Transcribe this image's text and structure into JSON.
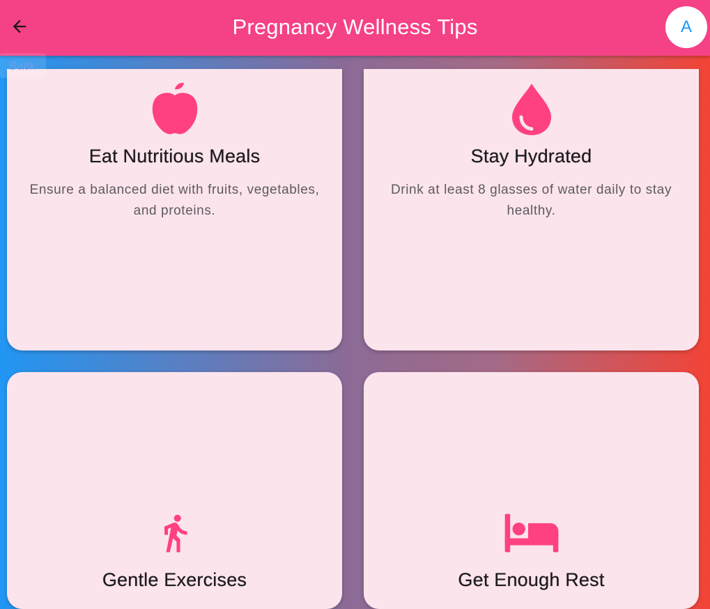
{
  "app_bar": {
    "title": "Pregnancy Wellness Tips",
    "avatar_letter": "A",
    "back_label": "Back",
    "color": "#F54185"
  },
  "tips": [
    {
      "title": "Eat Nutritious Meals",
      "description": "Ensure a balanced diet with fruits, vegetables, and proteins.",
      "icon": "apple-icon"
    },
    {
      "title": "Stay Hydrated",
      "description": "Drink at least 8 glasses of water daily to stay healthy.",
      "icon": "water-drop-icon"
    },
    {
      "title": "Gentle Exercises",
      "description": "",
      "icon": "walking-icon"
    },
    {
      "title": "Get Enough Rest",
      "description": "",
      "icon": "bed-icon"
    }
  ],
  "colors": {
    "accent": "#FF4081",
    "card_bg": "#FBE4EC",
    "gradient_start": "#2196F3",
    "gradient_end": "#F44336"
  }
}
